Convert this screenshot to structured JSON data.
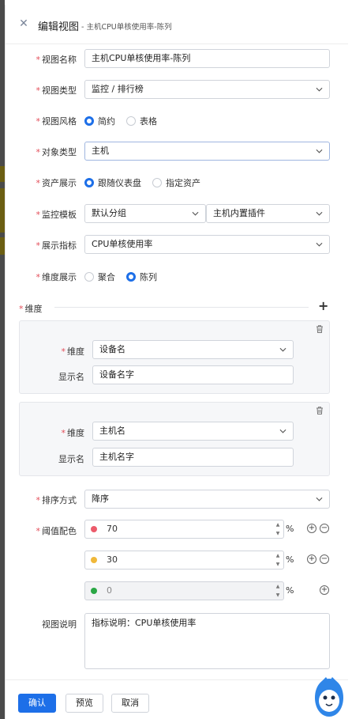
{
  "header": {
    "title": "编辑视图",
    "subtitle": "- 主机CPU单核使用率-陈列"
  },
  "form": {
    "view_name": {
      "label": "视图名称",
      "value": "主机CPU单核使用率-陈列"
    },
    "view_type": {
      "label": "视图类型",
      "value": "监控 / 排行榜"
    },
    "view_style": {
      "label": "视图风格",
      "options": [
        "简约",
        "表格"
      ],
      "selected": "简约"
    },
    "object_type": {
      "label": "对象类型",
      "value": "主机"
    },
    "asset_display": {
      "label": "资产展示",
      "options": [
        "跟随仪表盘",
        "指定资产"
      ],
      "selected": "跟随仪表盘"
    },
    "monitor_template": {
      "label": "监控模板",
      "value1": "默认分组",
      "value2": "主机内置插件"
    },
    "display_metric": {
      "label": "展示指标",
      "value": "CPU单核使用率"
    },
    "dimension_display": {
      "label": "维度展示",
      "options": [
        "聚合",
        "陈列"
      ],
      "selected": "陈列"
    },
    "dimension_section": {
      "label": "维度"
    },
    "dimensions": [
      {
        "dim_label": "维度",
        "dim_value": "设备名",
        "display_label": "显示名",
        "display_value": "设备名字"
      },
      {
        "dim_label": "维度",
        "dim_value": "主机名",
        "display_label": "显示名",
        "display_value": "主机名字"
      }
    ],
    "sort": {
      "label": "排序方式",
      "value": "降序"
    },
    "threshold": {
      "label": "阈值配色",
      "unit": "%",
      "items": [
        {
          "value": "70",
          "color": "#ec5b6b"
        },
        {
          "value": "30",
          "color": "#f0b83a"
        },
        {
          "value": "0",
          "color": "#2aa745"
        }
      ]
    },
    "description": {
      "label": "视图说明",
      "value": "指标说明：CPU单核使用率"
    }
  },
  "footer": {
    "confirm": "确认",
    "preview": "预览",
    "cancel": "取消"
  },
  "colors": {
    "accent": "#1d6fe8",
    "required": "#e34d59"
  },
  "icons": [
    "close-icon",
    "chevron-down-icon",
    "plus-icon",
    "trash-icon",
    "spin-up-icon",
    "spin-down-icon",
    "add-circle-icon",
    "remove-circle-icon",
    "mascot-icon"
  ]
}
